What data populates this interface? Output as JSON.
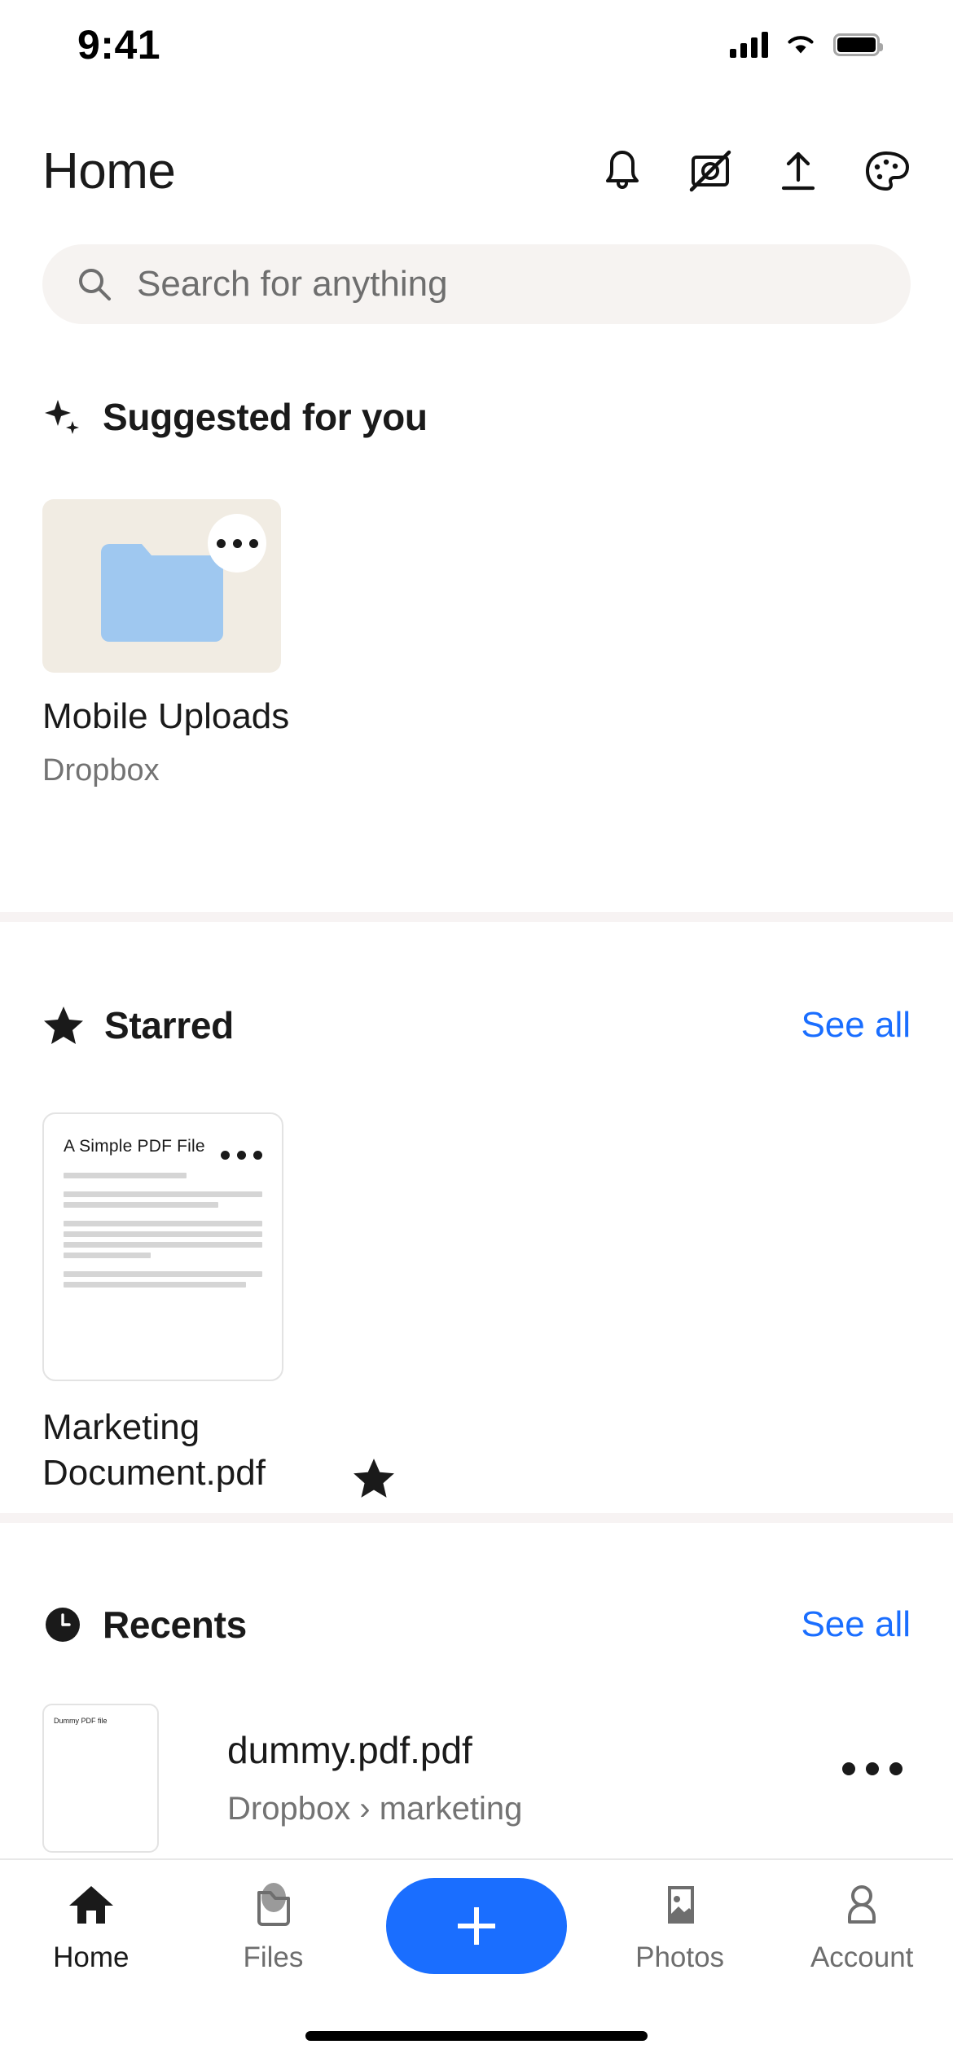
{
  "status_bar": {
    "time": "9:41",
    "cellular_icon": "cellular-bars-icon",
    "wifi_icon": "wifi-icon",
    "battery_icon": "battery-full-icon"
  },
  "header": {
    "title": "Home",
    "actions": [
      {
        "name": "notifications-bell-icon",
        "label": "Notifications"
      },
      {
        "name": "photo-slash-icon",
        "label": "Camera uploads off"
      },
      {
        "name": "upload-icon",
        "label": "Upload"
      },
      {
        "name": "palette-icon",
        "label": "Theme"
      }
    ]
  },
  "search": {
    "placeholder": "Search for anything",
    "value": "",
    "icon": "search-icon"
  },
  "sections": {
    "suggested": {
      "icon": "sparkle-icon",
      "title": "Suggested for you",
      "card": {
        "thumbnail": "folder-icon",
        "name": "Mobile Uploads",
        "subtitle": "Dropbox",
        "overflow_icon": "ellipsis-icon"
      }
    },
    "starred": {
      "icon": "star-icon",
      "title": "Starred",
      "see_all": "See all",
      "card": {
        "thumbnail": "pdf-preview",
        "preview_title": "A Simple PDF File",
        "name": "Marketing Document.pdf",
        "starred_icon": "star-filled-icon",
        "overflow_icon": "ellipsis-icon"
      }
    },
    "recents": {
      "icon": "clock-icon",
      "title": "Recents",
      "see_all": "See all",
      "items": [
        {
          "thumbnail_title": "Dummy PDF file",
          "name": "dummy.pdf.pdf",
          "path": "Dropbox › marketing",
          "overflow_icon": "ellipsis-icon"
        }
      ]
    }
  },
  "tab_bar": {
    "tabs": [
      {
        "label": "Home",
        "icon": "home-icon",
        "active": true
      },
      {
        "label": "Files",
        "icon": "folder-icon",
        "active": false
      },
      {
        "label": "Photos",
        "icon": "photo-icon",
        "active": false
      },
      {
        "label": "Account",
        "icon": "person-icon",
        "active": false
      }
    ],
    "create_button": {
      "icon": "plus-icon",
      "label": "Create"
    }
  },
  "colors": {
    "accent_blue": "#1a6eff",
    "suggested_card_bg": "#f1ece3",
    "folder_blue": "#9fc8f0",
    "search_bg": "#f6f3f1",
    "divider": "#f7f3f3"
  }
}
